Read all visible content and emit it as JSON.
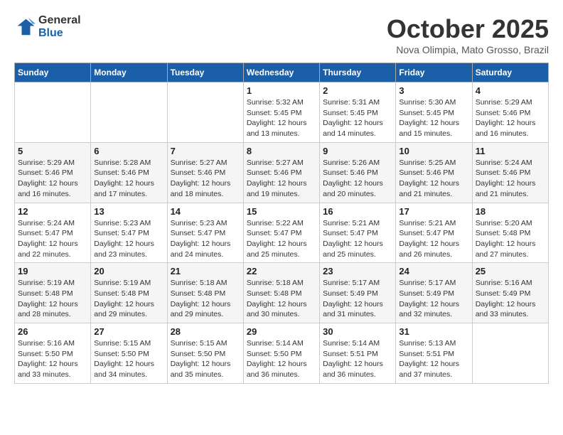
{
  "header": {
    "logo_line1": "General",
    "logo_line2": "Blue",
    "month": "October 2025",
    "location": "Nova Olimpia, Mato Grosso, Brazil"
  },
  "weekdays": [
    "Sunday",
    "Monday",
    "Tuesday",
    "Wednesday",
    "Thursday",
    "Friday",
    "Saturday"
  ],
  "weeks": [
    [
      {
        "day": "",
        "info": ""
      },
      {
        "day": "",
        "info": ""
      },
      {
        "day": "",
        "info": ""
      },
      {
        "day": "1",
        "info": "Sunrise: 5:32 AM\nSunset: 5:45 PM\nDaylight: 12 hours\nand 13 minutes."
      },
      {
        "day": "2",
        "info": "Sunrise: 5:31 AM\nSunset: 5:45 PM\nDaylight: 12 hours\nand 14 minutes."
      },
      {
        "day": "3",
        "info": "Sunrise: 5:30 AM\nSunset: 5:45 PM\nDaylight: 12 hours\nand 15 minutes."
      },
      {
        "day": "4",
        "info": "Sunrise: 5:29 AM\nSunset: 5:46 PM\nDaylight: 12 hours\nand 16 minutes."
      }
    ],
    [
      {
        "day": "5",
        "info": "Sunrise: 5:29 AM\nSunset: 5:46 PM\nDaylight: 12 hours\nand 16 minutes."
      },
      {
        "day": "6",
        "info": "Sunrise: 5:28 AM\nSunset: 5:46 PM\nDaylight: 12 hours\nand 17 minutes."
      },
      {
        "day": "7",
        "info": "Sunrise: 5:27 AM\nSunset: 5:46 PM\nDaylight: 12 hours\nand 18 minutes."
      },
      {
        "day": "8",
        "info": "Sunrise: 5:27 AM\nSunset: 5:46 PM\nDaylight: 12 hours\nand 19 minutes."
      },
      {
        "day": "9",
        "info": "Sunrise: 5:26 AM\nSunset: 5:46 PM\nDaylight: 12 hours\nand 20 minutes."
      },
      {
        "day": "10",
        "info": "Sunrise: 5:25 AM\nSunset: 5:46 PM\nDaylight: 12 hours\nand 21 minutes."
      },
      {
        "day": "11",
        "info": "Sunrise: 5:24 AM\nSunset: 5:46 PM\nDaylight: 12 hours\nand 21 minutes."
      }
    ],
    [
      {
        "day": "12",
        "info": "Sunrise: 5:24 AM\nSunset: 5:47 PM\nDaylight: 12 hours\nand 22 minutes."
      },
      {
        "day": "13",
        "info": "Sunrise: 5:23 AM\nSunset: 5:47 PM\nDaylight: 12 hours\nand 23 minutes."
      },
      {
        "day": "14",
        "info": "Sunrise: 5:23 AM\nSunset: 5:47 PM\nDaylight: 12 hours\nand 24 minutes."
      },
      {
        "day": "15",
        "info": "Sunrise: 5:22 AM\nSunset: 5:47 PM\nDaylight: 12 hours\nand 25 minutes."
      },
      {
        "day": "16",
        "info": "Sunrise: 5:21 AM\nSunset: 5:47 PM\nDaylight: 12 hours\nand 25 minutes."
      },
      {
        "day": "17",
        "info": "Sunrise: 5:21 AM\nSunset: 5:47 PM\nDaylight: 12 hours\nand 26 minutes."
      },
      {
        "day": "18",
        "info": "Sunrise: 5:20 AM\nSunset: 5:48 PM\nDaylight: 12 hours\nand 27 minutes."
      }
    ],
    [
      {
        "day": "19",
        "info": "Sunrise: 5:19 AM\nSunset: 5:48 PM\nDaylight: 12 hours\nand 28 minutes."
      },
      {
        "day": "20",
        "info": "Sunrise: 5:19 AM\nSunset: 5:48 PM\nDaylight: 12 hours\nand 29 minutes."
      },
      {
        "day": "21",
        "info": "Sunrise: 5:18 AM\nSunset: 5:48 PM\nDaylight: 12 hours\nand 29 minutes."
      },
      {
        "day": "22",
        "info": "Sunrise: 5:18 AM\nSunset: 5:48 PM\nDaylight: 12 hours\nand 30 minutes."
      },
      {
        "day": "23",
        "info": "Sunrise: 5:17 AM\nSunset: 5:49 PM\nDaylight: 12 hours\nand 31 minutes."
      },
      {
        "day": "24",
        "info": "Sunrise: 5:17 AM\nSunset: 5:49 PM\nDaylight: 12 hours\nand 32 minutes."
      },
      {
        "day": "25",
        "info": "Sunrise: 5:16 AM\nSunset: 5:49 PM\nDaylight: 12 hours\nand 33 minutes."
      }
    ],
    [
      {
        "day": "26",
        "info": "Sunrise: 5:16 AM\nSunset: 5:50 PM\nDaylight: 12 hours\nand 33 minutes."
      },
      {
        "day": "27",
        "info": "Sunrise: 5:15 AM\nSunset: 5:50 PM\nDaylight: 12 hours\nand 34 minutes."
      },
      {
        "day": "28",
        "info": "Sunrise: 5:15 AM\nSunset: 5:50 PM\nDaylight: 12 hours\nand 35 minutes."
      },
      {
        "day": "29",
        "info": "Sunrise: 5:14 AM\nSunset: 5:50 PM\nDaylight: 12 hours\nand 36 minutes."
      },
      {
        "day": "30",
        "info": "Sunrise: 5:14 AM\nSunset: 5:51 PM\nDaylight: 12 hours\nand 36 minutes."
      },
      {
        "day": "31",
        "info": "Sunrise: 5:13 AM\nSunset: 5:51 PM\nDaylight: 12 hours\nand 37 minutes."
      },
      {
        "day": "",
        "info": ""
      }
    ]
  ]
}
